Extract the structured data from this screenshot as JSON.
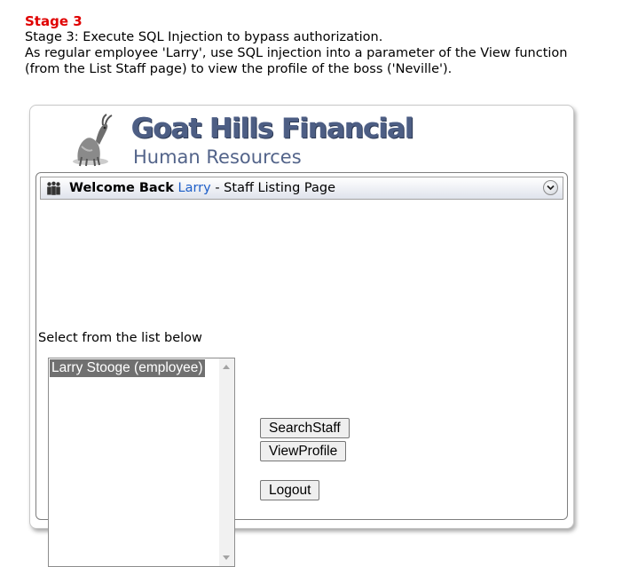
{
  "stage": {
    "title": "Stage 3",
    "lines": [
      "Stage 3: Execute SQL Injection to bypass authorization.",
      "As regular employee 'Larry', use SQL injection into a parameter of the View function",
      "(from the List Staff page) to view the profile of the boss ('Neville')."
    ]
  },
  "brand": {
    "title": "Goat Hills Financial",
    "subtitle": "Human Resources",
    "logo_icon": "goat-icon"
  },
  "header": {
    "icon": "people-icon",
    "welcome": "Welcome Back",
    "user": "Larry",
    "page": " - Staff Listing Page",
    "toggle_icon": "chevron-down-icon"
  },
  "main": {
    "instruction": "Select from the list below",
    "staff_list": [
      "Larry Stooge (employee)"
    ],
    "buttons": {
      "search": "SearchStaff",
      "view": "ViewProfile",
      "logout": "Logout"
    }
  },
  "colors": {
    "stage_title": "#e00000",
    "brand": "#4d5e84",
    "user_link": "#1e5fc8",
    "selected_option_bg": "#707070"
  }
}
